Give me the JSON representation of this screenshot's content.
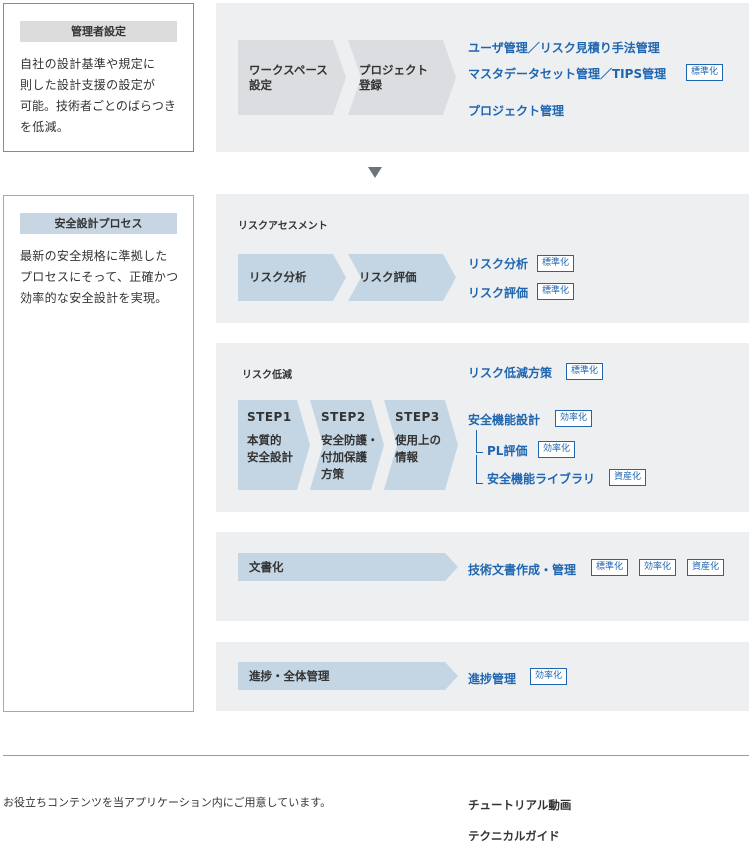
{
  "admin": {
    "tag": "管理者設定",
    "desc": [
      "自社の設計基準や規定に",
      "則した設計支援の設定が",
      "可能。技術者ごとのばらつき",
      "を低減。"
    ],
    "steps": [
      "ワークスペース\n設定",
      "プロジェクト\n登録"
    ],
    "links": [
      "ユーザ管理／リスク見積り手法管理",
      "マスタデータセット管理／TIPS管理",
      "プロジェクト管理"
    ],
    "badge": "標準化"
  },
  "safety": {
    "tag": "安全設計プロセス",
    "desc": [
      "最新の安全規格に準拠した",
      "プロセスにそって、正確かつ",
      "効率的な安全設計を実現。"
    ]
  },
  "risk_assessment": {
    "label": "リスクアセスメント",
    "steps": [
      "リスク分析",
      "リスク評価"
    ],
    "links": [
      "リスク分析",
      "リスク評価"
    ],
    "badges": [
      "標準化",
      "標準化"
    ]
  },
  "risk_reduction": {
    "label": "リスク低減",
    "steps": [
      {
        "num": "STEP1",
        "text": "本質的\n安全設計"
      },
      {
        "num": "STEP2",
        "text": "安全防護・\n付加保護\n方策"
      },
      {
        "num": "STEP3",
        "text": "使用上の\n情報"
      }
    ],
    "link_main": "リスク低減方策",
    "badge_main": "標準化",
    "link_func": "安全機能設計",
    "badge_func": "効率化",
    "link_pl": "PL評価",
    "badge_pl": "効率化",
    "link_lib": "安全機能ライブラリ",
    "badge_lib": "資産化"
  },
  "documentation": {
    "step": "文書化",
    "link": "技術文書作成・管理",
    "badges": [
      "標準化",
      "効率化",
      "資産化"
    ]
  },
  "progress": {
    "step": "進捗・全体管理",
    "link": "進捗管理",
    "badge": "効率化"
  },
  "footer": {
    "note": "お役立ちコンテンツを当アプリケーション内にご用意しています。",
    "resources": [
      "チュートリアル動画",
      "テクニカルガイド"
    ]
  }
}
